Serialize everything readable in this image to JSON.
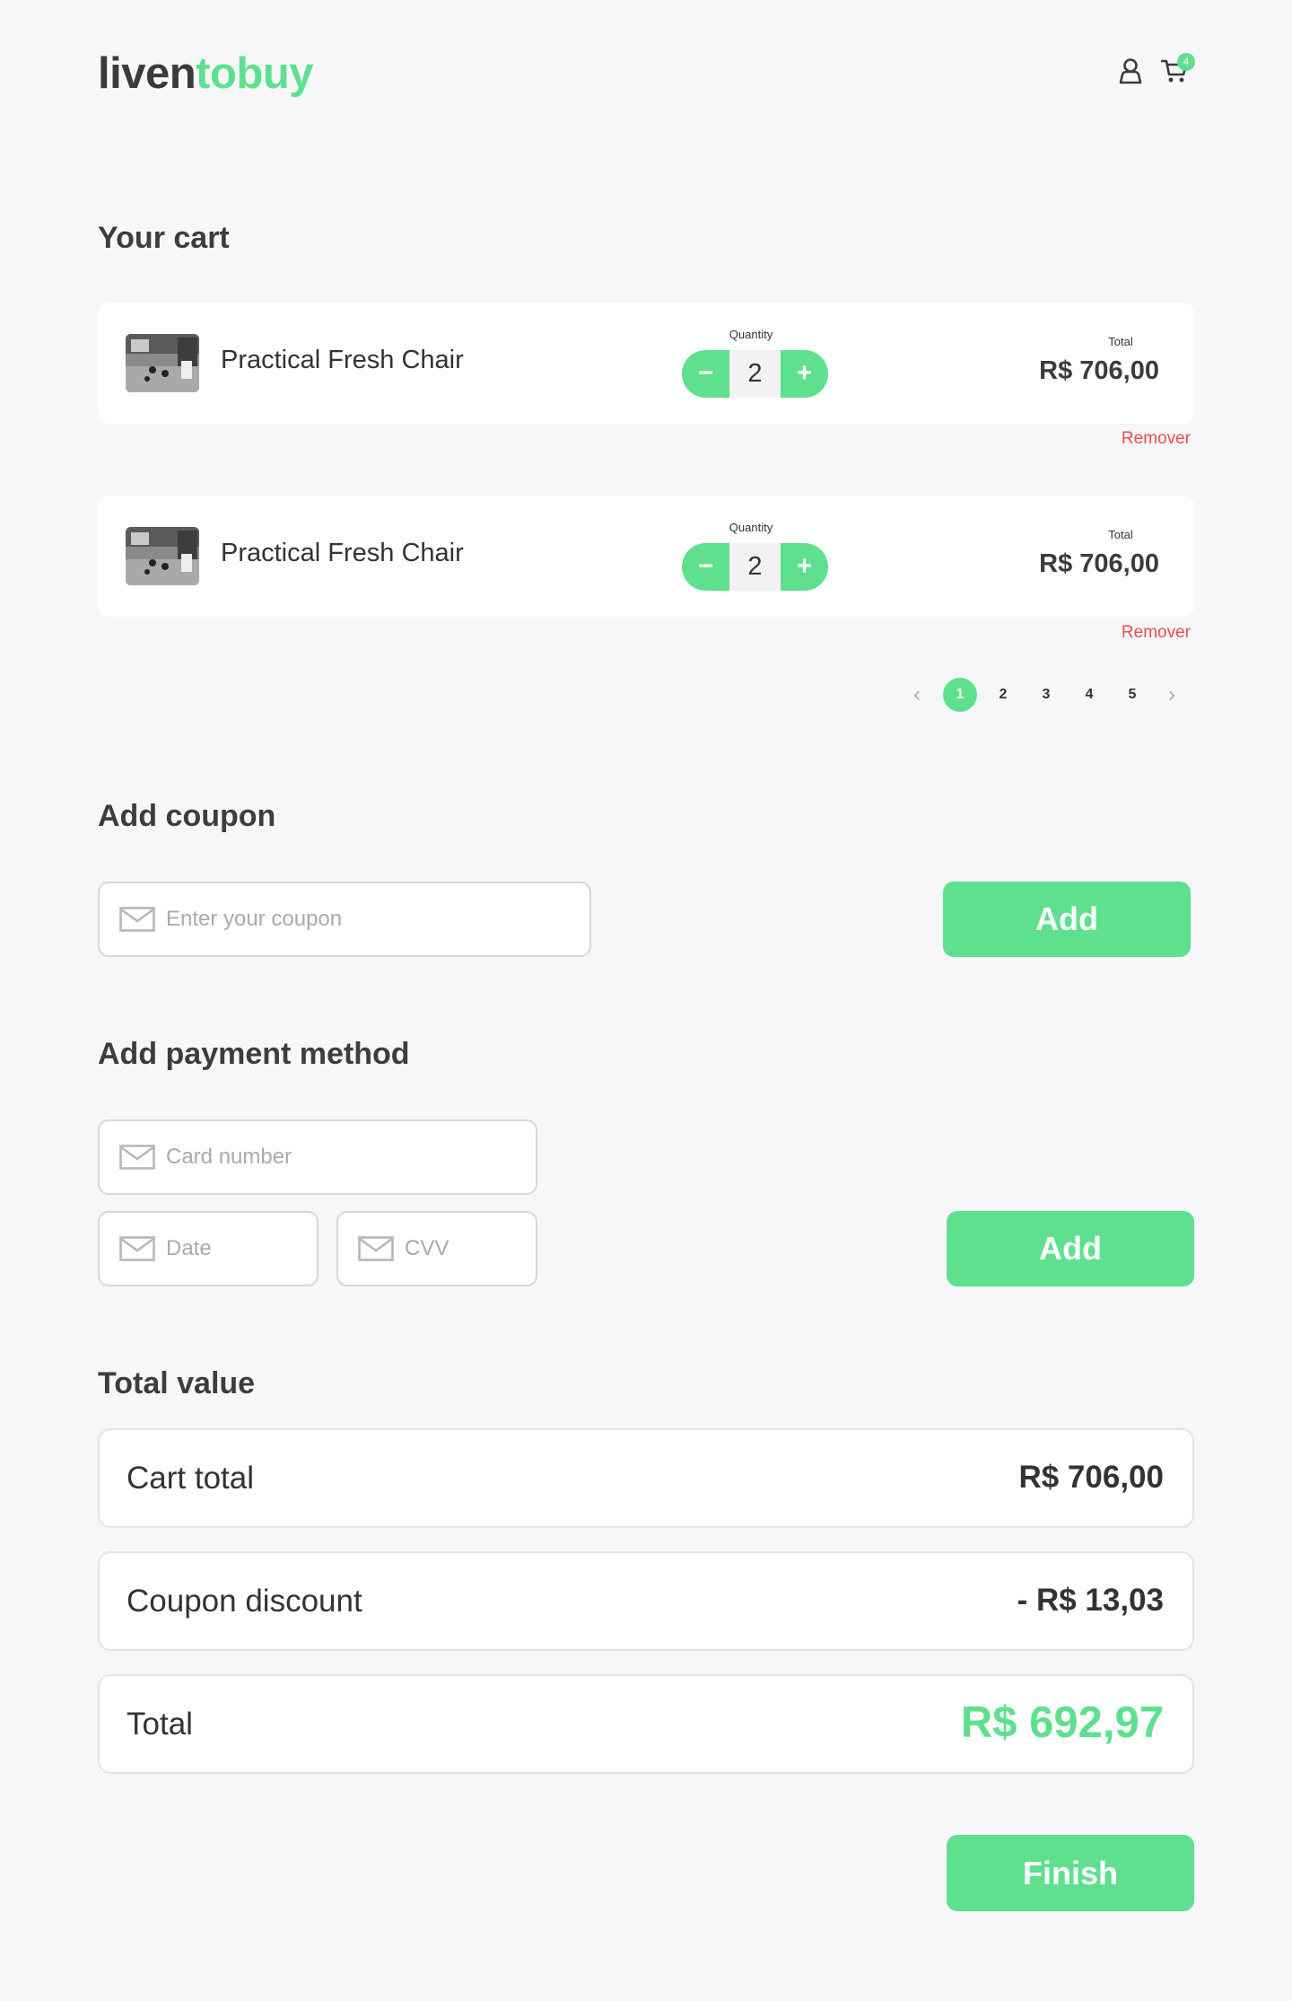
{
  "header": {
    "logo_part1": "liven",
    "logo_part2": "tobuy",
    "cart_count": "4",
    "colors": {
      "brand": "#5fe08f",
      "text": "#3b3b3b"
    },
    "icons": [
      "user-icon",
      "cart-icon"
    ]
  },
  "cart": {
    "title": "Your cart",
    "items": [
      {
        "name": "Practical Fresh Chair",
        "quantity_label": "Quantity",
        "quantity": "2",
        "total_label": "Total",
        "total": "R$ 706,00",
        "remove": "Remover",
        "minus": "−",
        "plus": "+"
      },
      {
        "name": "Practical Fresh Chair",
        "quantity_label": "Quantity",
        "quantity": "2",
        "total_label": "Total",
        "total": "R$ 706,00",
        "remove": "Remover",
        "minus": "−",
        "plus": "+"
      }
    ],
    "pagination": {
      "prev": "‹",
      "pages": [
        "1",
        "2",
        "3",
        "4",
        "5"
      ],
      "active": "1",
      "next": "›"
    }
  },
  "coupon": {
    "title": "Add coupon",
    "placeholder": "Enter your coupon",
    "button": "Add"
  },
  "payment": {
    "title": "Add payment method",
    "card_placeholder": "Card number",
    "date_placeholder": "Date",
    "cvv_placeholder": "CVV",
    "button": "Add"
  },
  "totals": {
    "title": "Total value",
    "cart_total_label": "Cart total",
    "cart_total": "R$ 706,00",
    "discount_label": "Coupon discount",
    "discount": "- R$ 13,03",
    "total_label": "Total",
    "total": "R$ 692,97"
  },
  "finish_button": "Finish"
}
